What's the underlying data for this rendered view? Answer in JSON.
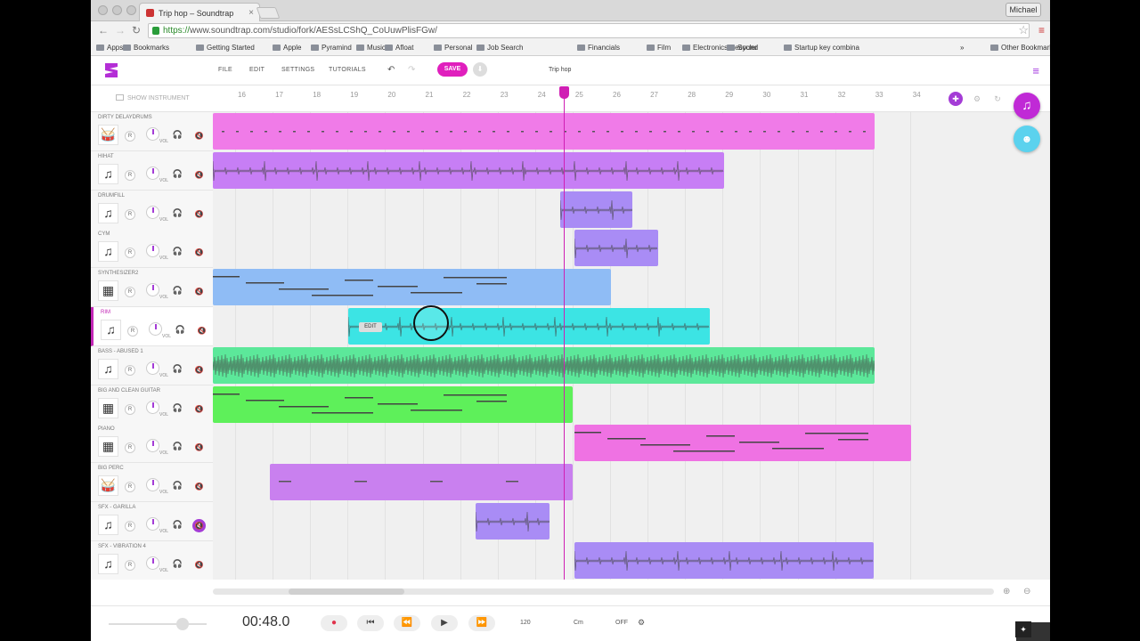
{
  "browser": {
    "tab_title": "Trip hop – Soundtrap",
    "user": "Michael",
    "url_https": "https://",
    "url_rest": "www.soundtrap.com/studio/fork/AESsLCShQ_CoUuwPlisFGw/",
    "bookmarks": [
      "Apps",
      "Bookmarks",
      "Getting Started",
      "Apple",
      "Pyramind",
      "Music",
      "Afloat",
      "Personal",
      "Job Search",
      "Financials",
      "Film",
      "Electronics Recycler",
      "Sound",
      "Startup key combina",
      "Other Bookmarks"
    ],
    "overflow": "»"
  },
  "app": {
    "menu": [
      "FILE",
      "EDIT",
      "SETTINGS",
      "TUTORIALS"
    ],
    "save": "SAVE",
    "project_title": "Trip hop",
    "show_instrument": "SHOW INSTRUMENT",
    "edit_label": "EDIT"
  },
  "ruler": {
    "bars": [
      "16",
      "17",
      "18",
      "19",
      "20",
      "21",
      "22",
      "23",
      "24",
      "25",
      "26",
      "27",
      "28",
      "29",
      "30",
      "31",
      "32",
      "33",
      "34"
    ]
  },
  "tracks": [
    {
      "name": "DIRTY DELAYDRUMS",
      "icon": "drum-icon",
      "glyph": "🥁",
      "color": "#f07be8",
      "muted": false
    },
    {
      "name": "HIHAT",
      "icon": "note-icon",
      "glyph": "♫",
      "color": "#c77ef5",
      "muted": false
    },
    {
      "name": "DRUMFILL",
      "icon": "note-icon",
      "glyph": "♫",
      "color": "#a98cf5",
      "muted": false
    },
    {
      "name": "CYM",
      "icon": "note-icon",
      "glyph": "♫",
      "color": "#a98cf5",
      "muted": false
    },
    {
      "name": "SYNTHESIZER2",
      "icon": "keyboard-icon",
      "glyph": "▦",
      "color": "#8fbcf5",
      "muted": false
    },
    {
      "name": "RIM",
      "icon": "note-icon",
      "glyph": "♫",
      "color": "#3ce4e4",
      "muted": false,
      "selected": true
    },
    {
      "name": "BASS - ABUSED 1",
      "icon": "note-icon",
      "glyph": "♫",
      "color": "#5ce89a",
      "muted": false
    },
    {
      "name": "BIG AND CLEAN GUITAR",
      "icon": "keyboard-icon",
      "glyph": "▦",
      "color": "#5ef05a",
      "muted": false
    },
    {
      "name": "PIANO",
      "icon": "keyboard-icon",
      "glyph": "▦",
      "color": "#ef72e3",
      "muted": false
    },
    {
      "name": "BIG PERC",
      "icon": "drum-icon",
      "glyph": "🥁",
      "color": "#c980ef",
      "muted": false
    },
    {
      "name": "SFX - GARILLA",
      "icon": "note-icon",
      "glyph": "♫",
      "color": "#a98cf5",
      "muted": true
    },
    {
      "name": "SFX - VIBRATION 4",
      "icon": "note-icon",
      "glyph": "♫",
      "color": "#a98cf5",
      "muted": false
    }
  ],
  "track_labels": {
    "record": "R",
    "vol": "VOL"
  },
  "transport": {
    "time": "00:48.0",
    "tempo": "120",
    "key": "Cm",
    "metronome": "OFF"
  }
}
